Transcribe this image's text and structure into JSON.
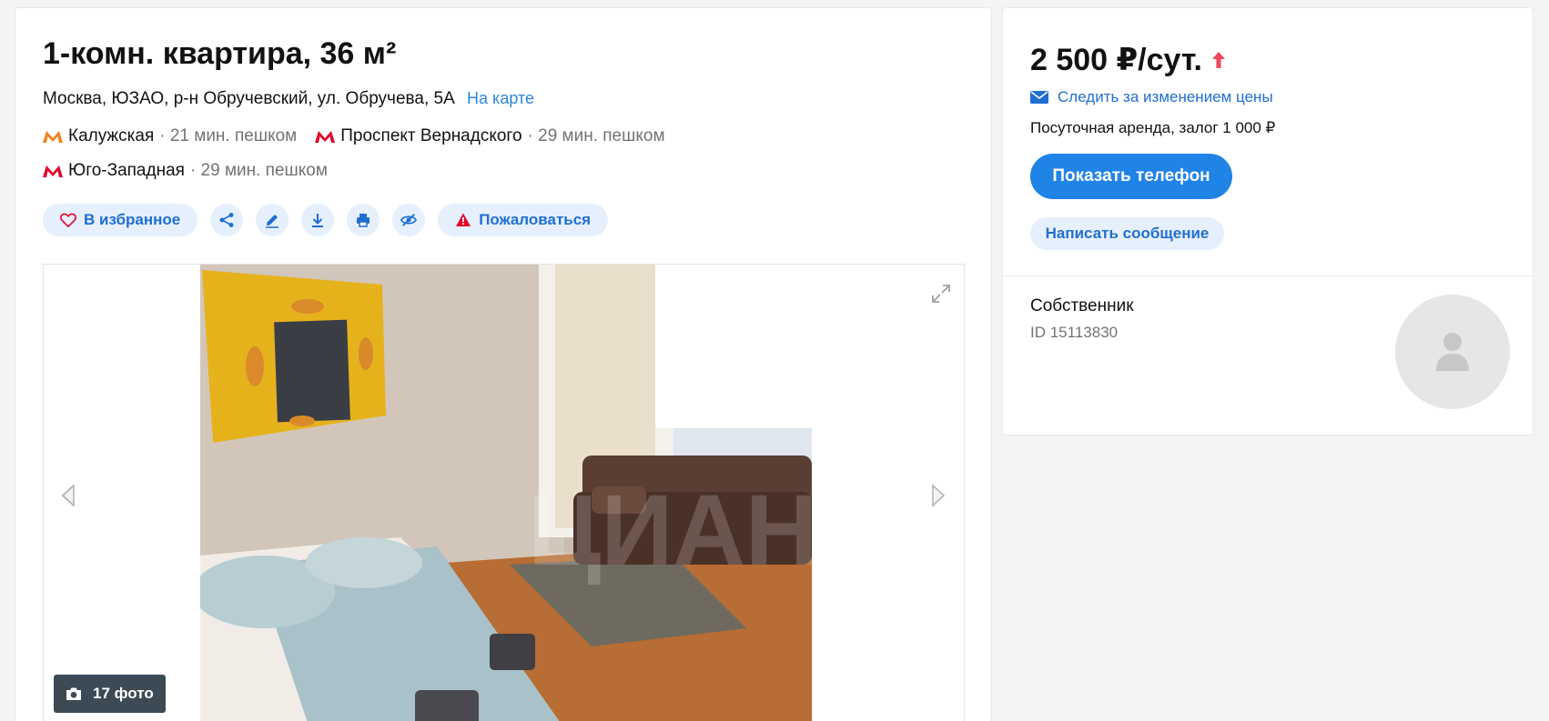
{
  "listing": {
    "title": "1-комн. квартира, 36 м²",
    "address": "Москва, ЮЗАО, р-н Обручевский, ул. Обручева, 5А",
    "map_link": "На карте",
    "metro": [
      {
        "name": "Калужская",
        "walk": "· 21 мин. пешком",
        "color": "#f58220"
      },
      {
        "name": "Проспект Вернадского",
        "walk": "· 29 мин. пешком",
        "color": "#e4002b"
      },
      {
        "name": "Юго-Западная",
        "walk": "· 29 мин. пешком",
        "color": "#e4002b"
      }
    ]
  },
  "actions": {
    "favorite": "В избранное",
    "complain": "Пожаловаться",
    "icons": [
      "share-icon",
      "edit-icon",
      "download-icon",
      "print-icon",
      "hide-icon"
    ]
  },
  "gallery": {
    "photo_count": "17 фото",
    "watermark": "ЦИАН"
  },
  "sidebar": {
    "price": "2 500 ₽/сут.",
    "watch_price": "Следить за изменением цены",
    "terms": "Посуточная аренда, залог 1 000 ₽",
    "show_phone": "Показать телефон",
    "write_message": "Написать сообщение",
    "owner_label": "Собственник",
    "owner_id": "ID 15113830"
  },
  "colors": {
    "accent": "#2083e6",
    "accent_light": "#e6f0fc",
    "price_up": "#f0475a"
  }
}
